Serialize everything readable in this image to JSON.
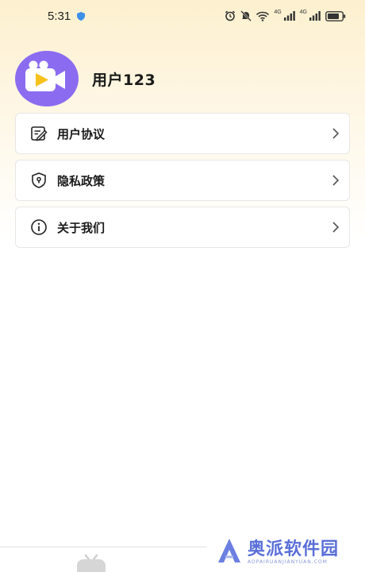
{
  "status_bar": {
    "time": "5:31",
    "signal1_label": "4G",
    "signal2_label": "4G"
  },
  "profile": {
    "username": "用户123",
    "avatar_icon": "video-camera-icon",
    "avatar_color": "#8b6cf0"
  },
  "menu": {
    "items": [
      {
        "label": "用户协议",
        "icon": "document-edit-icon"
      },
      {
        "label": "隐私政策",
        "icon": "shield-lock-icon"
      },
      {
        "label": "关于我们",
        "icon": "info-icon"
      }
    ]
  },
  "bottom_nav": {
    "tab_icon": "tv-icon"
  },
  "watermark": {
    "text": "奥派软件园",
    "sub": "AOPAIRUANJIANYUAN.COM",
    "color": "#5a6fd8"
  }
}
